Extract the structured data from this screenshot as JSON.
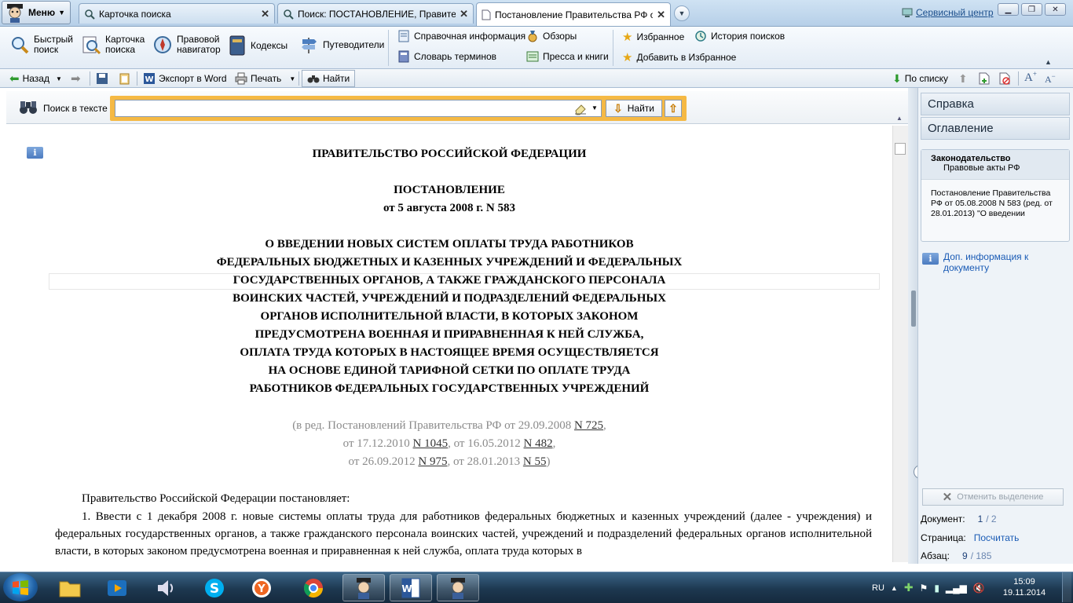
{
  "titlebar": {
    "menu_label": "Меню",
    "tabs": [
      {
        "label": "Карточка поиска",
        "icon": "search-icon"
      },
      {
        "label": "Поиск: ПОСТАНОВЛЕНИЕ, Правител...",
        "icon": "search-icon"
      },
      {
        "label": "Постановление Правительства РФ о...",
        "icon": "document-icon",
        "active": true
      }
    ],
    "service_center": "Сервисный центр"
  },
  "ribbon": {
    "quick_search": "Быстрый\nпоиск",
    "search_card": "Карточка\nпоиска",
    "legal_navigator": "Правовой\nнавигатор",
    "codes": "Кодексы",
    "guides": "Путеводители",
    "reference_info": "Справочная информация",
    "glossary": "Словарь терминов",
    "reviews": "Обзоры",
    "press_books": "Пресса и книги",
    "favorites": "Избранное",
    "add_favorites": "Добавить в Избранное",
    "search_history": "История поисков"
  },
  "toolbar": {
    "back": "Назад",
    "export_word": "Экспорт в Word",
    "print": "Печать",
    "find": "Найти",
    "by_list": "По списку"
  },
  "search": {
    "label": "Поиск в тексте",
    "value": "",
    "find_button": "Найти"
  },
  "document": {
    "org": "ПРАВИТЕЛЬСТВО РОССИЙСКОЙ ФЕДЕРАЦИИ",
    "type": "ПОСТАНОВЛЕНИЕ",
    "date": "от 5 августа 2008 г. N 583",
    "title_lines": [
      "О ВВЕДЕНИИ НОВЫХ СИСТЕМ ОПЛАТЫ ТРУДА РАБОТНИКОВ",
      "ФЕДЕРАЛЬНЫХ БЮДЖЕТНЫХ И КАЗЕННЫХ УЧРЕЖДЕНИЙ И ФЕДЕРАЛЬНЫХ",
      "ГОСУДАРСТВЕННЫХ ОРГАНОВ, А ТАКЖЕ ГРАЖДАНСКОГО ПЕРСОНАЛА",
      "ВОИНСКИХ ЧАСТЕЙ, УЧРЕЖДЕНИЙ И ПОДРАЗДЕЛЕНИЙ ФЕДЕРАЛЬНЫХ",
      "ОРГАНОВ ИСПОЛНИТЕЛЬНОЙ ВЛАСТИ, В КОТОРЫХ ЗАКОНОМ",
      "ПРЕДУСМОТРЕНА ВОЕННАЯ И ПРИРАВНЕННАЯ К НЕЙ СЛУЖБА,",
      "ОПЛАТА ТРУДА КОТОРЫХ В НАСТОЯЩЕЕ ВРЕМЯ ОСУЩЕСТВЛЯЕТСЯ",
      "НА ОСНОВЕ ЕДИНОЙ ТАРИФНОЙ СЕТКИ ПО ОПЛАТЕ ТРУДА",
      "РАБОТНИКОВ ФЕДЕРАЛЬНЫХ ГОСУДАРСТВЕННЫХ УЧРЕЖДЕНИЙ"
    ],
    "edition": {
      "l1_prefix": "(в ред. Постановлений Правительства РФ от 29.09.2008 ",
      "l1_link": "N 725",
      "l1_suffix": ",",
      "l2_a": "от 17.12.2010 ",
      "l2_link1": "N 1045",
      "l2_b": ", от 16.05.2012 ",
      "l2_link2": "N 482",
      "l2_c": ",",
      "l3_a": "от 26.09.2012 ",
      "l3_link1": "N 975",
      "l3_b": ", от 28.01.2013 ",
      "l3_link2": "N 55",
      "l3_c": ")"
    },
    "intro": "Правительство Российской Федерации постановляет:",
    "para1": "1. Ввести с 1 декабря 2008 г. новые системы оплаты труда для работников федеральных бюджетных и казенных учреждений (далее - учреждения) и федеральных государственных органов, а также гражданского персонала воинских частей, учреждений и подразделений федеральных органов исполнительной власти, в которых законом предусмотрена военная и приравненная к ней служба, оплата труда которых в"
  },
  "panel": {
    "tab_help": "Справка",
    "tab_contents": "Оглавление",
    "section": "Законодательство",
    "subsection": "Правовые акты РФ",
    "doc_ref": "Постановление Правительства РФ от 05.08.2008 N 583 (ред. от 28.01.2013) \"О введении",
    "extra_info": "Доп. информация к документу",
    "unselect": "Отменить выделение",
    "doc_label": "Документ:",
    "doc_cur": "1",
    "doc_total": "/ 2",
    "page_label": "Страница:",
    "page_value": "Посчитать",
    "para_label": "Абзац:",
    "para_cur": "9",
    "para_total": "/ 185"
  },
  "taskbar": {
    "lang": "RU",
    "time": "15:09",
    "date": "19.11.2014"
  }
}
